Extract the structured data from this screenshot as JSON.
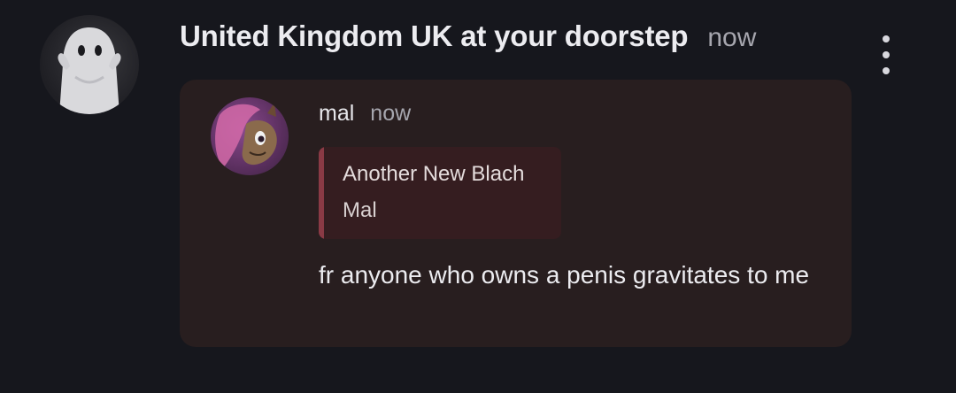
{
  "message": {
    "sender": "United Kingdom UK at your doorstep",
    "time": "now",
    "avatar_icon": "ghost-avatar",
    "more_icon": "vertical-dots-icon"
  },
  "forwarded": {
    "author": "mal",
    "time": "now",
    "avatar_icon": "pony-avatar",
    "quote": {
      "title": "Another New Blach",
      "body": "Mal"
    },
    "text": "fr anyone who owns a penis gravitates to me"
  },
  "colors": {
    "background": "#16171d",
    "bubble": "#281e1f",
    "quote_background": "#351d20",
    "quote_bar": "#8a3a45"
  }
}
